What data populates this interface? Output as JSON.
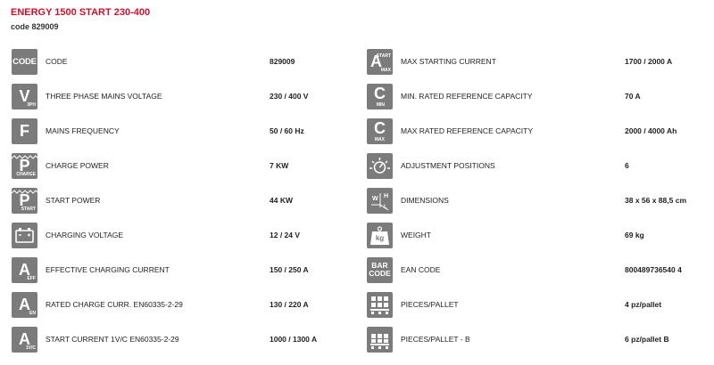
{
  "header": {
    "title": "ENERGY 1500 START 230-400",
    "code_line": "code 829009"
  },
  "colors": {
    "title": "#c8102e",
    "icon_bg": "#7b7b7b",
    "row_bg": "#f2f2f2"
  },
  "left_specs": [
    {
      "icon": "code-icon",
      "icon_text": "CODE",
      "icon_sub": "",
      "label": "CODE",
      "value": "829009"
    },
    {
      "icon": "voltage-3ph-icon",
      "icon_text": "V",
      "icon_sub": "3PH",
      "label": "THREE PHASE MAINS VOLTAGE",
      "value": "230 / 400 V"
    },
    {
      "icon": "frequency-icon",
      "icon_text": "F",
      "icon_sub": "",
      "label": "MAINS FREQUENCY",
      "value": "50 / 60 Hz"
    },
    {
      "icon": "power-charge-icon",
      "icon_text": "P",
      "icon_sub": "CHARGE",
      "label": "CHARGE POWER",
      "value": "7 KW"
    },
    {
      "icon": "power-start-icon",
      "icon_text": "P",
      "icon_sub": "START",
      "label": "START POWER",
      "value": "44 KW"
    },
    {
      "icon": "battery-icon",
      "icon_text": "",
      "icon_sub": "",
      "label": "CHARGING VOLTAGE",
      "value": "12 / 24 V"
    },
    {
      "icon": "current-eff-icon",
      "icon_text": "A",
      "icon_sub": "EFF",
      "label": "EFFECTIVE CHARGING CURRENT",
      "value": "150 / 250 A"
    },
    {
      "icon": "current-en-icon",
      "icon_text": "A",
      "icon_sub": "EN",
      "label": "RATED CHARGE CURR. EN60335-2-29",
      "value": "130 / 220 A"
    },
    {
      "icon": "current-start-icon",
      "icon_text": "A",
      "icon_sub": "1V/C",
      "label": "START CURRENT 1V/C EN60335-2-29",
      "value": "1000 / 1300 A"
    }
  ],
  "right_specs": [
    {
      "icon": "current-start-max-icon",
      "icon_text": "A",
      "icon_sub": "MAX",
      "icon_sup": "START",
      "label": "MAX STARTING CURRENT",
      "value": "1700 / 2000 A"
    },
    {
      "icon": "capacity-min-icon",
      "icon_text": "C",
      "icon_sub": "MIN",
      "label": "MIN. RATED REFERENCE CAPACITY",
      "value": "70 A"
    },
    {
      "icon": "capacity-max-icon",
      "icon_text": "C",
      "icon_sub": "MAX",
      "label": "MAX RATED REFERENCE CAPACITY",
      "value": "2000 / 4000 Ah"
    },
    {
      "icon": "adjustment-icon",
      "icon_text": "",
      "icon_sub": "",
      "label": "ADJUSTMENT POSITIONS",
      "value": "6"
    },
    {
      "icon": "dimensions-icon",
      "icon_text": "",
      "icon_sub": "",
      "label": "DIMENSIONS",
      "value": "38 x 56 x 88,5 cm"
    },
    {
      "icon": "weight-icon",
      "icon_text": "kg",
      "icon_sub": "",
      "label": "WEIGHT",
      "value": "69 kg"
    },
    {
      "icon": "barcode-icon",
      "icon_text": "BAR CODE",
      "icon_sub": "",
      "label": "EAN CODE",
      "value": "800489736540 4"
    },
    {
      "icon": "pallet-icon",
      "icon_text": "",
      "icon_sub": "",
      "label": "PIECES/PALLET",
      "value": "4 pz/pallet"
    },
    {
      "icon": "pallet-b-icon",
      "icon_text": "",
      "icon_sub": "",
      "label": "PIECES/PALLET - B",
      "value": "6 pz/pallet B"
    }
  ]
}
